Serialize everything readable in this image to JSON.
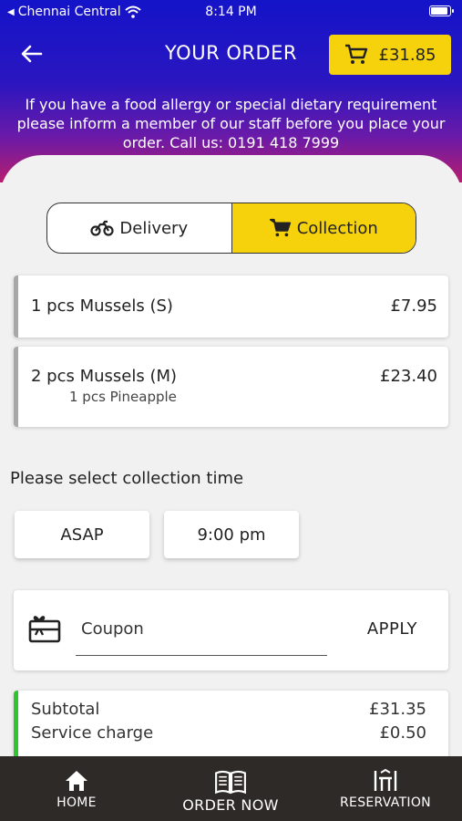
{
  "status_bar": {
    "carrier": "Chennai Central",
    "time": "8:14 PM"
  },
  "header": {
    "title": "YOUR ORDER",
    "cart_total": "£31.85",
    "notice": "If you have a food allergy or special dietary requirement please inform a member of our staff before you place your order. Call us: 0191 418 7999"
  },
  "order_type": {
    "delivery_label": "Delivery",
    "collection_label": "Collection",
    "selected": "collection"
  },
  "items": [
    {
      "name": "1 pcs Mussels (S)",
      "price": "£7.95",
      "sub": ""
    },
    {
      "name": "2 pcs Mussels (M)",
      "price": "£23.40",
      "sub": "1 pcs  Pineapple"
    }
  ],
  "collection_time": {
    "label": "Please select collection time",
    "asap_label": "ASAP",
    "time_label": "9:00 pm"
  },
  "coupon": {
    "placeholder": "Coupon",
    "apply_label": "APPLY"
  },
  "summary": {
    "subtotal_label": "Subtotal",
    "subtotal_value": "£31.35",
    "service_label": "Service charge",
    "service_value": "£0.50"
  },
  "bottom_nav": {
    "home": "HOME",
    "order_now": "ORDER NOW",
    "reservation": "RESERVATION"
  },
  "colors": {
    "accent": "#f6d20c",
    "header_top": "#1414c8",
    "header_bottom": "#b61e6e",
    "summary_bar": "#2ec52e",
    "nav_bg": "#2d2a27"
  }
}
